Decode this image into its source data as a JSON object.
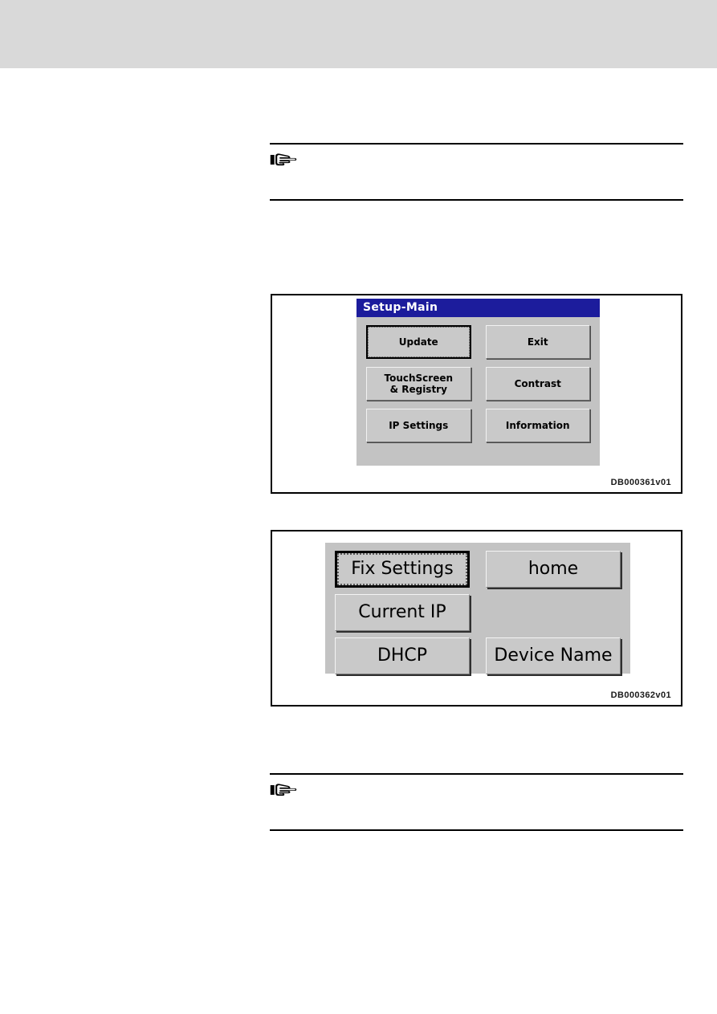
{
  "page": {
    "header_band_color": "#d9d9d9",
    "background_color": "#ffffff"
  },
  "notes": [
    {
      "icon": "pointing-hand-icon",
      "text": ""
    },
    {
      "icon": "pointing-hand-icon",
      "text": ""
    }
  ],
  "figures": [
    {
      "caption": "DB000361v01",
      "screen": {
        "titlebar": {
          "title": "Setup-Main",
          "background_color": "#1c1c9c",
          "text_color": "#ffffff"
        },
        "background_color": "#c3c3c3",
        "buttons": [
          {
            "label": "Update",
            "default": true,
            "blank": false
          },
          {
            "label": "Exit",
            "default": false,
            "blank": false
          },
          {
            "label": "TouchScreen\n& Registry",
            "default": false,
            "blank": false
          },
          {
            "label": "Contrast",
            "default": false,
            "blank": false
          },
          {
            "label": "IP Settings",
            "default": false,
            "blank": false
          },
          {
            "label": "Information",
            "default": false,
            "blank": false
          }
        ]
      }
    },
    {
      "caption": "DB000362v01",
      "screen": {
        "background_color": "#c3c3c3",
        "buttons": [
          {
            "label": "Fix Settings",
            "default": true,
            "blank": false
          },
          {
            "label": "home",
            "default": false,
            "blank": false
          },
          {
            "label": "Current IP",
            "default": false,
            "blank": false
          },
          {
            "label": "",
            "default": false,
            "blank": true
          },
          {
            "label": "DHCP",
            "default": false,
            "blank": false
          },
          {
            "label": "Device Name",
            "default": false,
            "blank": false
          }
        ]
      }
    }
  ]
}
